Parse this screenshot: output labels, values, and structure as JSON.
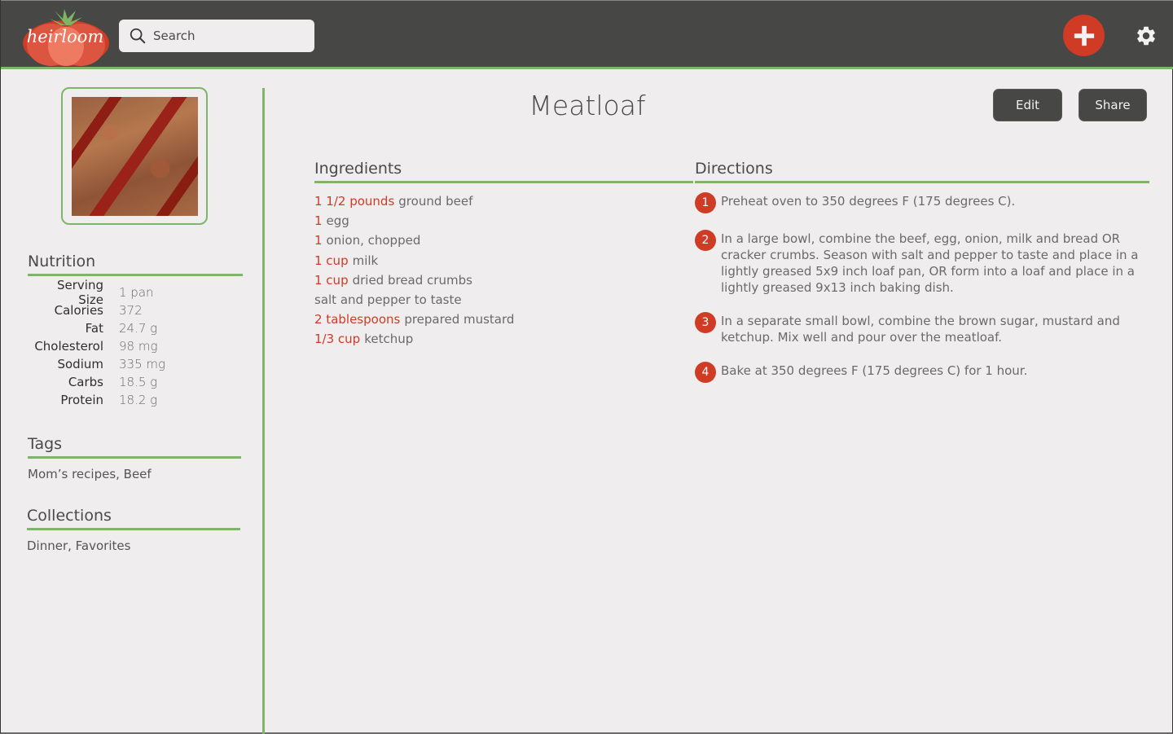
{
  "header": {
    "logo_text": "heirloom",
    "search_placeholder": "Search",
    "add_icon": "plus-icon",
    "settings_icon": "gear-icon"
  },
  "colors": {
    "accent_red": "#cf3b25",
    "accent_green": "#7fb56b",
    "header_bg": "#474746",
    "page_bg": "#efedee"
  },
  "recipe": {
    "title": "Meatloaf",
    "edit_label": "Edit",
    "share_label": "Share",
    "image_alt": "meatloaf-photo"
  },
  "sidebar": {
    "nutrition_title": "Nutrition",
    "nutrition": [
      {
        "label": "Serving Size",
        "value": "1 pan"
      },
      {
        "label": "Calories",
        "value": "372"
      },
      {
        "label": "Fat",
        "value": "24.7 g"
      },
      {
        "label": "Cholesterol",
        "value": "98 mg"
      },
      {
        "label": "Sodium",
        "value": "335 mg"
      },
      {
        "label": "Carbs",
        "value": "18.5 g"
      },
      {
        "label": "Protein",
        "value": "18.2 g"
      }
    ],
    "tags_title": "Tags",
    "tags": "Mom’s recipes, Beef",
    "collections_title": "Collections",
    "collections": "Dinner, Favorites"
  },
  "ingredients": {
    "title": "Ingredients",
    "items": [
      {
        "qty": "1 1/2 pounds",
        "name": "ground beef"
      },
      {
        "qty": "1",
        "name": "egg"
      },
      {
        "qty": "1",
        "name": "onion, chopped"
      },
      {
        "qty": "1 cup",
        "name": "milk"
      },
      {
        "qty": "1 cup",
        "name": "dried bread crumbs"
      },
      {
        "qty": "",
        "name": "salt and pepper to taste"
      },
      {
        "qty": "2 tablespoons",
        "name": "prepared mustard"
      },
      {
        "qty": "1/3 cup",
        "name": "ketchup"
      }
    ]
  },
  "directions": {
    "title": "Directions",
    "steps": [
      {
        "num": "1",
        "text": "Preheat oven to 350 degrees F (175 degrees C)."
      },
      {
        "num": "2",
        "text": "In a large bowl, combine the beef, egg, onion, milk and bread OR cracker crumbs. Season with salt and pepper to taste and place in a lightly greased 5x9 inch loaf pan, OR form into a loaf and place in a lightly greased 9x13 inch baking dish."
      },
      {
        "num": "3",
        "text": "In a separate small bowl, combine the brown sugar, mustard and ketchup. Mix well and pour over the meatloaf."
      },
      {
        "num": "4",
        "text": "Bake at 350 degrees F (175 degrees C) for 1 hour."
      }
    ]
  }
}
